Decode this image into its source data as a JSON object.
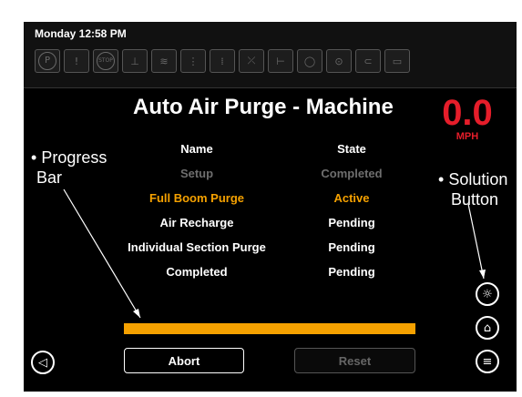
{
  "status_bar": {
    "clock": "Monday 12:58 PM",
    "icons": [
      {
        "name": "park-brake-icon",
        "glyph": "P",
        "round": true
      },
      {
        "name": "warning-icon",
        "glyph": "!",
        "round": false
      },
      {
        "name": "stop-icon",
        "glyph": "STOP",
        "round": true
      },
      {
        "name": "spray-boom-icon",
        "glyph": "⊥",
        "round": false
      },
      {
        "name": "tank-level-icon",
        "glyph": "≋",
        "round": false
      },
      {
        "name": "section-left-icon",
        "glyph": "⋮",
        "round": false
      },
      {
        "name": "section-center-icon",
        "glyph": "⁞",
        "round": false
      },
      {
        "name": "no-spray-icon",
        "glyph": "⤫",
        "round": false
      },
      {
        "name": "fill-icon",
        "glyph": "⊢",
        "round": false
      },
      {
        "name": "valve-icon",
        "glyph": "◯",
        "round": false
      },
      {
        "name": "pressure-icon",
        "glyph": "⊙",
        "round": false
      },
      {
        "name": "hitch-icon",
        "glyph": "⊂",
        "round": false
      },
      {
        "name": "filter-icon",
        "glyph": "▭",
        "round": false
      }
    ]
  },
  "screen": {
    "title": "Auto Air Purge - Machine",
    "speed": {
      "value": "0.0",
      "unit": "MPH",
      "color": "#e51d2a"
    },
    "table": {
      "headers": {
        "name": "Name",
        "state": "State"
      },
      "rows": [
        {
          "name": "Setup",
          "state": "Completed",
          "status": "done"
        },
        {
          "name": "Full Boom Purge",
          "state": "Active",
          "status": "active"
        },
        {
          "name": "Air Recharge",
          "state": "Pending",
          "status": "pending"
        },
        {
          "name": "Individual Section Purge",
          "state": "Pending",
          "status": "pending"
        },
        {
          "name": "Completed",
          "state": "Pending",
          "status": "pending"
        }
      ]
    },
    "progress_color": "#f5a100",
    "buttons": {
      "abort": "Abort",
      "reset": "Reset"
    }
  },
  "callouts": {
    "progress_bar": {
      "bullet": "•",
      "line1": "Progress",
      "line2": "Bar"
    },
    "solution_button": {
      "bullet": "•",
      "line1": "Solution",
      "line2": "Button"
    }
  },
  "nav_icons": {
    "back": "back-arrow-icon",
    "solution": "solution-icon",
    "home": "home-icon",
    "menu": "menu-icon"
  }
}
